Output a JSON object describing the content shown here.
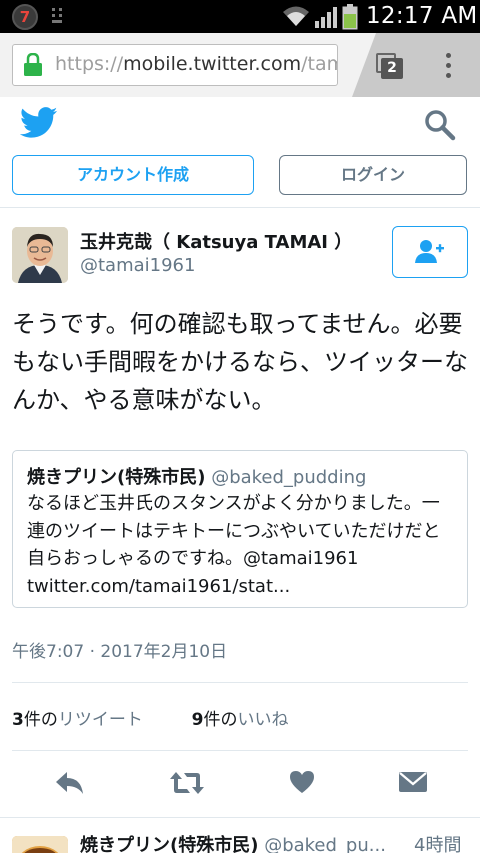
{
  "status_bar": {
    "notification_count": "7",
    "time": "12:17 AM"
  },
  "browser": {
    "url_prefix": "https://",
    "url_host": "mobile.twitter.com",
    "url_rest": "/tam",
    "tab_count": "2"
  },
  "header": {
    "signup_label": "アカウント作成",
    "login_label": "ログイン",
    "brand_color": "#1da1f2"
  },
  "tweet": {
    "author_name": "玉井克哉（ Katsuya TAMAI ）",
    "author_handle": "@tamai1961",
    "text": "そうです。何の確認も取ってません。必要もない手間暇をかけるなら、ツイッターなんか、やる意味がない。",
    "quote": {
      "name": "焼きプリン(特殊市民)",
      "handle": "@baked_pudding",
      "text": "なるほど玉井氏のスタンスがよく分かりました。一連のツイートはテキトーにつぶやいていただけだと自らおっしゃるのですね。@tamai1961 twitter.com/tamai1961/stat..."
    },
    "timestamp": "午後7:07 · 2017年2月10日",
    "retweet_count": "3",
    "retweet_unit": "件の",
    "retweet_label": "リツイート",
    "like_count": "9",
    "like_unit": "件の",
    "like_label": "いいね"
  },
  "next_tweet": {
    "name": "焼きプリン(特殊市民)",
    "handle": "@baked_pu...",
    "time": "4時間"
  }
}
